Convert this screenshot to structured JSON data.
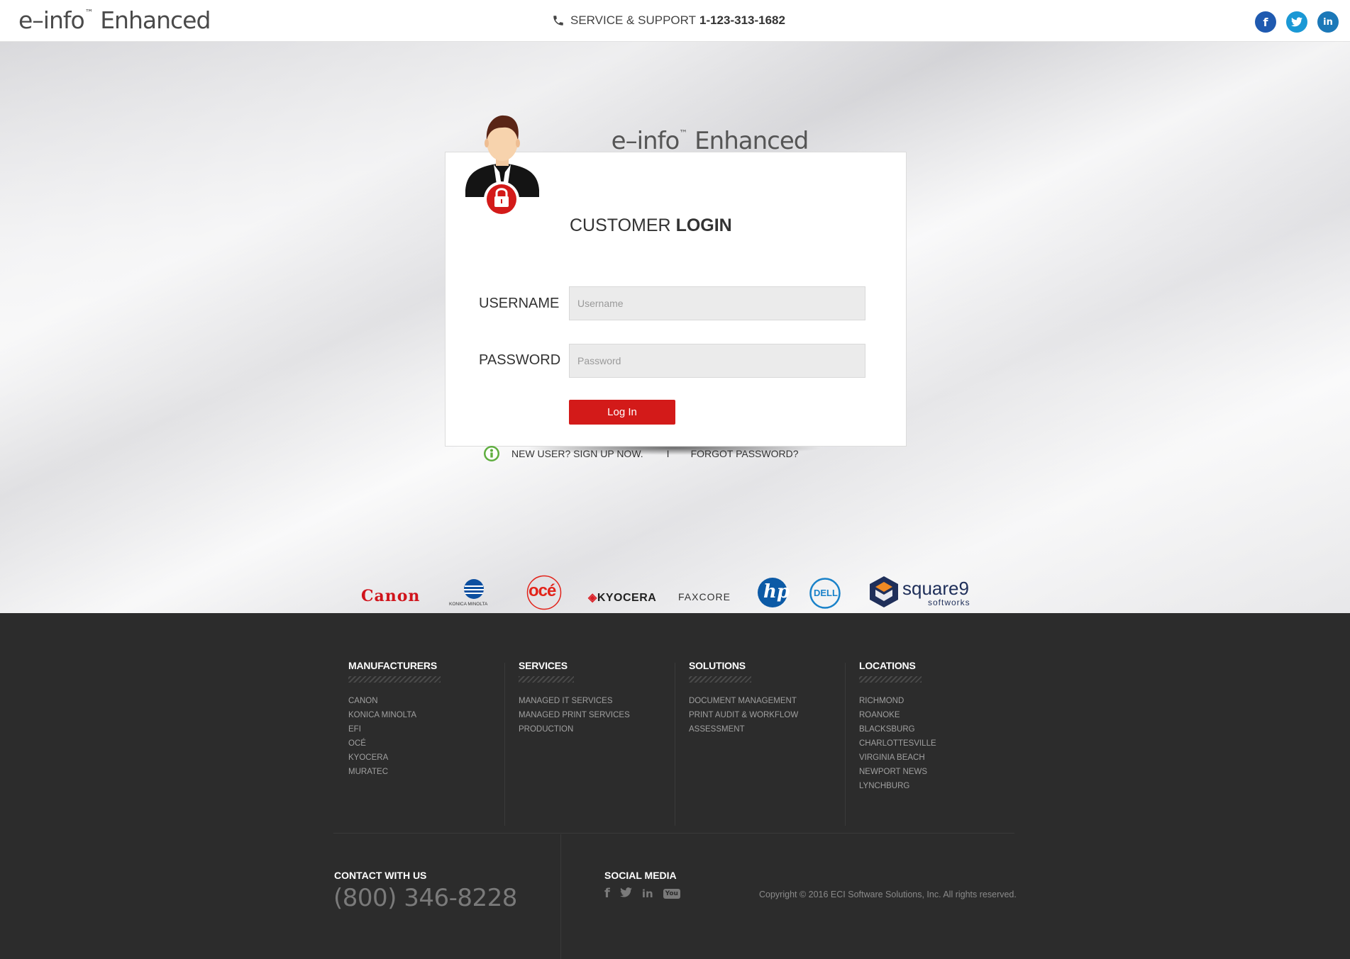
{
  "header": {
    "logo_main": "e–info",
    "logo_tm": "™",
    "logo_suffix": "Enhanced",
    "support_label": "SERVICE & SUPPORT",
    "support_number": "1-123-313-1682",
    "social": [
      {
        "name": "facebook-icon",
        "glyph": "f",
        "color": "#1f5ab0"
      },
      {
        "name": "twitter-icon",
        "glyph": "t",
        "color": "#1a98d5"
      },
      {
        "name": "linkedin-icon",
        "glyph": "in",
        "color": "#1b78b8"
      }
    ]
  },
  "hero": {
    "title_main": "e–info",
    "title_tm": "™",
    "title_suffix": "Enhanced"
  },
  "login": {
    "title_normal": "CUSTOMER",
    "title_bold": "LOGIN",
    "username_label": "USERNAME",
    "username_placeholder": "Username",
    "username_value": "",
    "password_label": "PASSWORD",
    "password_placeholder": "Password",
    "password_value": "",
    "submit_label": "Log In",
    "new_user_label": "NEW USER? SIGN UP NOW.",
    "separator": "I",
    "forgot_label": "FORGOT PASSWORD?"
  },
  "brands": [
    {
      "name": "Canon",
      "color": "#d0141c"
    },
    {
      "name": "KONICA MINOLTA",
      "color": "#0b4fa0"
    },
    {
      "name": "océ",
      "color": "#e2231a"
    },
    {
      "name": "KYOCERA",
      "color": "#d91f26"
    },
    {
      "name": "FAXCORE",
      "color": "#333333"
    },
    {
      "name": "hp",
      "color": "#0c5aa6"
    },
    {
      "name": "DELL",
      "color": "#1a82c9"
    },
    {
      "name": "square9",
      "sub": "softworks",
      "color": "#1f2f5a",
      "accent": "#f08a24"
    }
  ],
  "footer": {
    "columns": [
      {
        "heading": "MANUFACTURERS",
        "items": [
          "CANON",
          "KONICA MINOLTA",
          "EFI",
          "OCÉ",
          "KYOCERA",
          "MURATEC"
        ]
      },
      {
        "heading": "SERVICES",
        "items": [
          "MANAGED IT SERVICES",
          "MANAGED PRINT SERVICES",
          "PRODUCTION"
        ]
      },
      {
        "heading": "SOLUTIONS",
        "items": [
          "DOCUMENT MANAGEMENT",
          "PRINT AUDIT & WORKFLOW",
          "ASSESSMENT"
        ]
      },
      {
        "heading": "LOCATIONS",
        "items": [
          "RICHMOND",
          "ROANOKE",
          "BLACKSBURG",
          "CHARLOTTESVILLE",
          "VIRGINIA BEACH",
          "NEWPORT NEWS",
          "LYNCHBURG"
        ]
      }
    ],
    "contact_heading": "CONTACT WITH US",
    "contact_number": "(800) 346-8228",
    "social_heading": "SOCIAL MEDIA",
    "social_icons": [
      {
        "name": "facebook-icon",
        "glyph": "f"
      },
      {
        "name": "twitter-icon",
        "glyph": "t"
      },
      {
        "name": "linkedin-icon",
        "glyph": "in"
      },
      {
        "name": "youtube-icon",
        "glyph": "You"
      }
    ],
    "copyright": "Copyright © 2016 ECI Software Solutions, Inc. All rights reserved."
  }
}
